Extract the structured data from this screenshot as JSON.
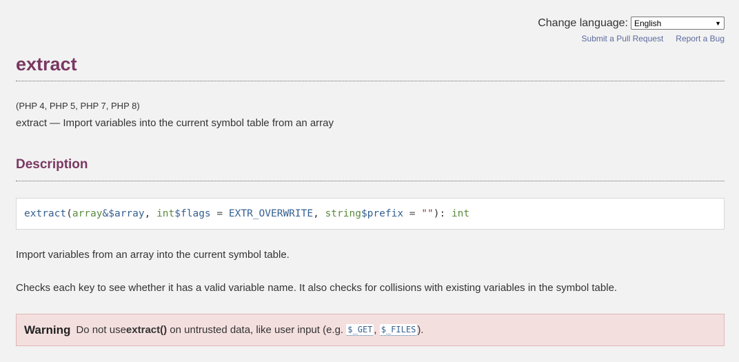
{
  "header": {
    "change_language_label": "Change language:",
    "language_selected": "English",
    "submit_pull_request": "Submit a Pull Request",
    "report_bug": "Report a Bug"
  },
  "function": {
    "name": "extract",
    "versions": "(PHP 4, PHP 5, PHP 7, PHP 8)",
    "refpurpose": "extract — Import variables into the current symbol table from an array"
  },
  "description": {
    "heading": "Description",
    "synopsis": {
      "func": "extract",
      "open": "(",
      "type1": "array",
      "param1": "&$array",
      "sep1": ", ",
      "type2": "int",
      "param2": "$flags",
      "eq2": " = ",
      "default2": "EXTR_OVERWRITE",
      "sep2": ", ",
      "type3": "string",
      "param3": "$prefix",
      "eq3": " = ",
      "default3": "\"\"",
      "close": "): ",
      "return_type": "int"
    },
    "para1": "Import variables from an array into the current symbol table.",
    "para2": "Checks each key to see whether it has a valid variable name. It also checks for collisions with existing variables in the symbol table."
  },
  "warning": {
    "label": "Warning",
    "text_before": "Do not use ",
    "code_func": "extract()",
    "text_middle": " on untrusted data, like user input (e.g. ",
    "var1": "$_GET",
    "comma": ", ",
    "var2": "$_FILES",
    "text_end": ")."
  }
}
